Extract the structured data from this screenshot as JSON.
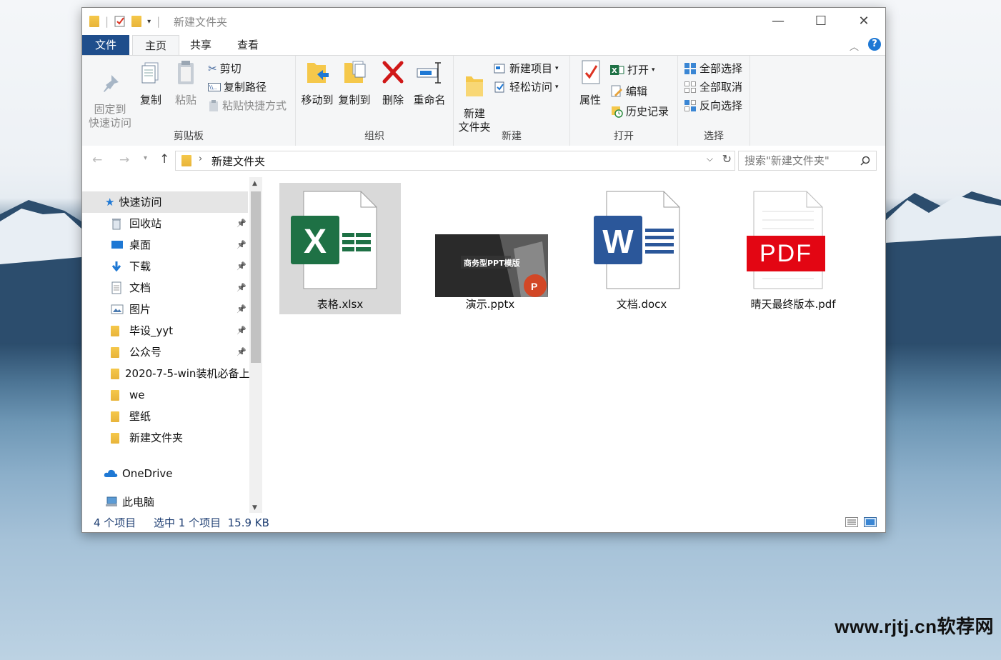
{
  "window": {
    "title": "新建文件夹"
  },
  "menu": {
    "tabs": [
      "文件",
      "主页",
      "共享",
      "查看"
    ]
  },
  "ribbon": {
    "clipboard": {
      "label": "剪贴板",
      "pin": "固定到\n快速访问",
      "copy": "复制",
      "paste": "粘贴",
      "cut": "剪切",
      "copy_path": "复制路径",
      "paste_shortcut": "粘贴快捷方式"
    },
    "organize": {
      "label": "组织",
      "move_to": "移动到",
      "copy_to": "复制到",
      "delete": "删除",
      "rename": "重命名"
    },
    "new": {
      "label": "新建",
      "new_folder": "新建\n文件夹",
      "new_item": "新建项目",
      "easy_access": "轻松访问"
    },
    "open": {
      "label": "打开",
      "properties": "属性",
      "open": "打开",
      "edit": "编辑",
      "history": "历史记录"
    },
    "select": {
      "label": "选择",
      "select_all": "全部选择",
      "select_none": "全部取消",
      "invert": "反向选择"
    }
  },
  "address": {
    "path": "新建文件夹",
    "search_placeholder": "搜索\"新建文件夹\""
  },
  "nav": {
    "quick_access": "快速访问",
    "items": [
      "回收站",
      "桌面",
      "下载",
      "文档",
      "图片",
      "毕设_yyt",
      "公众号",
      "2020-7-5-win装机必备上",
      "we",
      "壁纸",
      "新建文件夹"
    ],
    "onedrive": "OneDrive",
    "this_pc": "此电脑"
  },
  "files": [
    {
      "name": "表格.xlsx",
      "type": "excel-icon"
    },
    {
      "name": "演示.pptx",
      "type": "ppt-thumbnail",
      "thumb_text": "商务型PPT模版"
    },
    {
      "name": "文档.docx",
      "type": "word-icon"
    },
    {
      "name": "晴天最终版本.pdf",
      "type": "pdf-icon",
      "badge": "PDF"
    }
  ],
  "status": {
    "count": "4 个项目",
    "selection": "选中 1 个项目  15.9 KB"
  },
  "watermark": "www.rjtj.cn软荐网",
  "colors": {
    "accent": "#1f4e8c",
    "excel": "#1e7145",
    "word": "#2b579a",
    "pdf": "#e30613",
    "ppt": "#d24726"
  }
}
